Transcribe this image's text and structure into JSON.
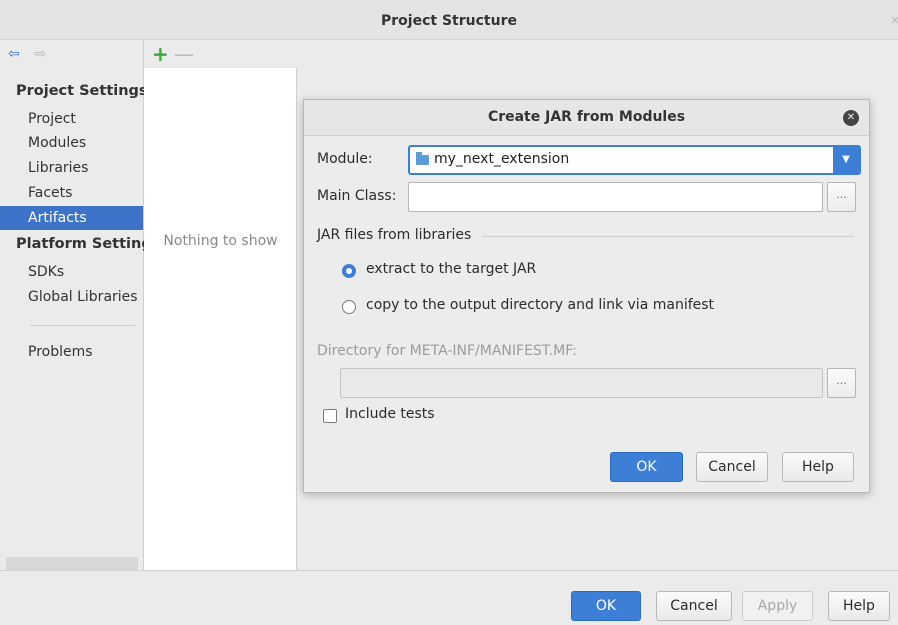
{
  "window": {
    "title": "Project Structure",
    "close_glyph": "×"
  },
  "nav": {
    "back_glyph": "⇦",
    "forward_glyph": "⇨",
    "section_project": "Project Settings",
    "items_project": [
      "Project",
      "Modules",
      "Libraries",
      "Facets",
      "Artifacts"
    ],
    "section_platform": "Platform Settings",
    "items_platform": [
      "SDKs",
      "Global Libraries"
    ],
    "problems": "Problems",
    "selected": "Artifacts"
  },
  "list": {
    "add_glyph": "+",
    "remove_glyph": "—",
    "empty_text": "Nothing to show"
  },
  "dialog": {
    "title": "Create JAR from Modules",
    "module_label": "Module:",
    "module_value": "my_next_extension",
    "main_class_label": "Main Class:",
    "main_class_value": "",
    "browse_glyph": "...",
    "jar_group_label": "JAR files from libraries",
    "radio_extract": "extract to the target JAR",
    "radio_copy": "copy to the output directory and link via manifest",
    "selected_option": "extract",
    "manifest_dir_label": "Directory for META-INF/MANIFEST.MF:",
    "manifest_dir_value": "",
    "include_tests": "Include tests",
    "include_tests_checked": false,
    "ok": "OK",
    "cancel": "Cancel",
    "help": "Help",
    "dropdown_glyph": "▼"
  },
  "footer": {
    "ok": "OK",
    "cancel": "Cancel",
    "apply": "Apply",
    "help": "Help"
  },
  "colors": {
    "accent": "#3d7fd6",
    "selection": "#3d74c9",
    "add_green": "#3aa83a"
  }
}
